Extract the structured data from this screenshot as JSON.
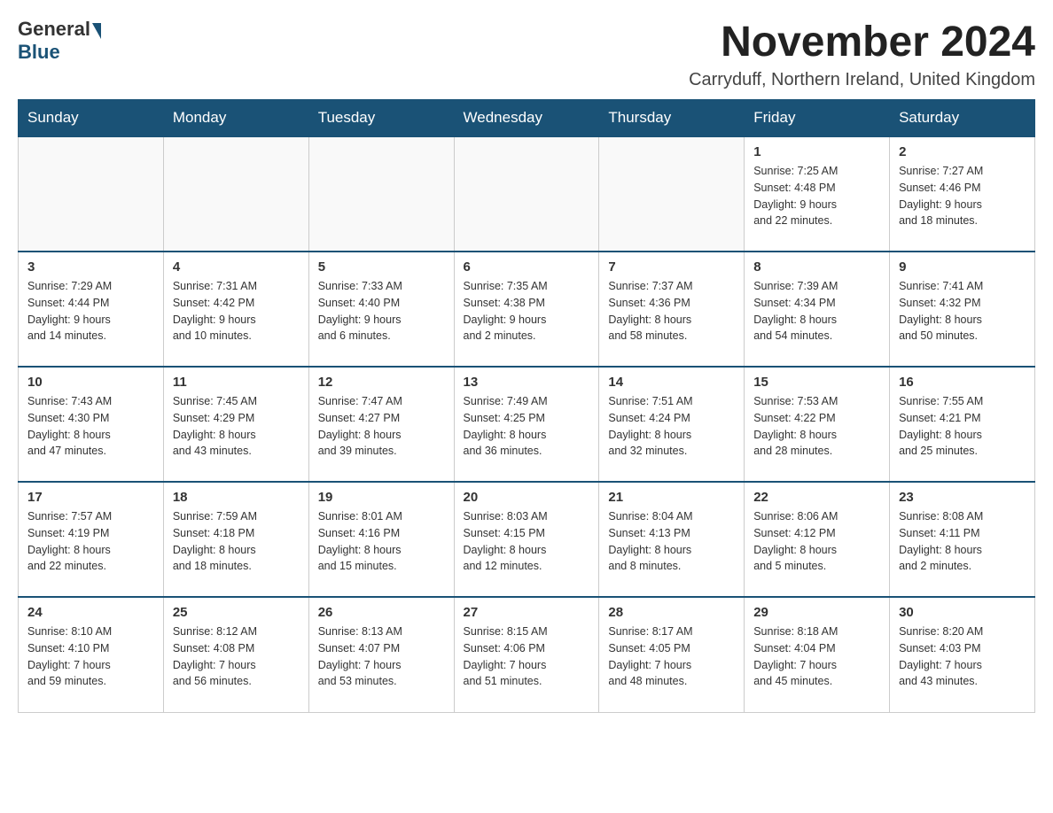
{
  "logo": {
    "general": "General",
    "blue": "Blue"
  },
  "title": "November 2024",
  "subtitle": "Carryduff, Northern Ireland, United Kingdom",
  "days_header": [
    "Sunday",
    "Monday",
    "Tuesday",
    "Wednesday",
    "Thursday",
    "Friday",
    "Saturday"
  ],
  "weeks": [
    [
      {
        "day": "",
        "info": ""
      },
      {
        "day": "",
        "info": ""
      },
      {
        "day": "",
        "info": ""
      },
      {
        "day": "",
        "info": ""
      },
      {
        "day": "",
        "info": ""
      },
      {
        "day": "1",
        "info": "Sunrise: 7:25 AM\nSunset: 4:48 PM\nDaylight: 9 hours\nand 22 minutes."
      },
      {
        "day": "2",
        "info": "Sunrise: 7:27 AM\nSunset: 4:46 PM\nDaylight: 9 hours\nand 18 minutes."
      }
    ],
    [
      {
        "day": "3",
        "info": "Sunrise: 7:29 AM\nSunset: 4:44 PM\nDaylight: 9 hours\nand 14 minutes."
      },
      {
        "day": "4",
        "info": "Sunrise: 7:31 AM\nSunset: 4:42 PM\nDaylight: 9 hours\nand 10 minutes."
      },
      {
        "day": "5",
        "info": "Sunrise: 7:33 AM\nSunset: 4:40 PM\nDaylight: 9 hours\nand 6 minutes."
      },
      {
        "day": "6",
        "info": "Sunrise: 7:35 AM\nSunset: 4:38 PM\nDaylight: 9 hours\nand 2 minutes."
      },
      {
        "day": "7",
        "info": "Sunrise: 7:37 AM\nSunset: 4:36 PM\nDaylight: 8 hours\nand 58 minutes."
      },
      {
        "day": "8",
        "info": "Sunrise: 7:39 AM\nSunset: 4:34 PM\nDaylight: 8 hours\nand 54 minutes."
      },
      {
        "day": "9",
        "info": "Sunrise: 7:41 AM\nSunset: 4:32 PM\nDaylight: 8 hours\nand 50 minutes."
      }
    ],
    [
      {
        "day": "10",
        "info": "Sunrise: 7:43 AM\nSunset: 4:30 PM\nDaylight: 8 hours\nand 47 minutes."
      },
      {
        "day": "11",
        "info": "Sunrise: 7:45 AM\nSunset: 4:29 PM\nDaylight: 8 hours\nand 43 minutes."
      },
      {
        "day": "12",
        "info": "Sunrise: 7:47 AM\nSunset: 4:27 PM\nDaylight: 8 hours\nand 39 minutes."
      },
      {
        "day": "13",
        "info": "Sunrise: 7:49 AM\nSunset: 4:25 PM\nDaylight: 8 hours\nand 36 minutes."
      },
      {
        "day": "14",
        "info": "Sunrise: 7:51 AM\nSunset: 4:24 PM\nDaylight: 8 hours\nand 32 minutes."
      },
      {
        "day": "15",
        "info": "Sunrise: 7:53 AM\nSunset: 4:22 PM\nDaylight: 8 hours\nand 28 minutes."
      },
      {
        "day": "16",
        "info": "Sunrise: 7:55 AM\nSunset: 4:21 PM\nDaylight: 8 hours\nand 25 minutes."
      }
    ],
    [
      {
        "day": "17",
        "info": "Sunrise: 7:57 AM\nSunset: 4:19 PM\nDaylight: 8 hours\nand 22 minutes."
      },
      {
        "day": "18",
        "info": "Sunrise: 7:59 AM\nSunset: 4:18 PM\nDaylight: 8 hours\nand 18 minutes."
      },
      {
        "day": "19",
        "info": "Sunrise: 8:01 AM\nSunset: 4:16 PM\nDaylight: 8 hours\nand 15 minutes."
      },
      {
        "day": "20",
        "info": "Sunrise: 8:03 AM\nSunset: 4:15 PM\nDaylight: 8 hours\nand 12 minutes."
      },
      {
        "day": "21",
        "info": "Sunrise: 8:04 AM\nSunset: 4:13 PM\nDaylight: 8 hours\nand 8 minutes."
      },
      {
        "day": "22",
        "info": "Sunrise: 8:06 AM\nSunset: 4:12 PM\nDaylight: 8 hours\nand 5 minutes."
      },
      {
        "day": "23",
        "info": "Sunrise: 8:08 AM\nSunset: 4:11 PM\nDaylight: 8 hours\nand 2 minutes."
      }
    ],
    [
      {
        "day": "24",
        "info": "Sunrise: 8:10 AM\nSunset: 4:10 PM\nDaylight: 7 hours\nand 59 minutes."
      },
      {
        "day": "25",
        "info": "Sunrise: 8:12 AM\nSunset: 4:08 PM\nDaylight: 7 hours\nand 56 minutes."
      },
      {
        "day": "26",
        "info": "Sunrise: 8:13 AM\nSunset: 4:07 PM\nDaylight: 7 hours\nand 53 minutes."
      },
      {
        "day": "27",
        "info": "Sunrise: 8:15 AM\nSunset: 4:06 PM\nDaylight: 7 hours\nand 51 minutes."
      },
      {
        "day": "28",
        "info": "Sunrise: 8:17 AM\nSunset: 4:05 PM\nDaylight: 7 hours\nand 48 minutes."
      },
      {
        "day": "29",
        "info": "Sunrise: 8:18 AM\nSunset: 4:04 PM\nDaylight: 7 hours\nand 45 minutes."
      },
      {
        "day": "30",
        "info": "Sunrise: 8:20 AM\nSunset: 4:03 PM\nDaylight: 7 hours\nand 43 minutes."
      }
    ]
  ]
}
